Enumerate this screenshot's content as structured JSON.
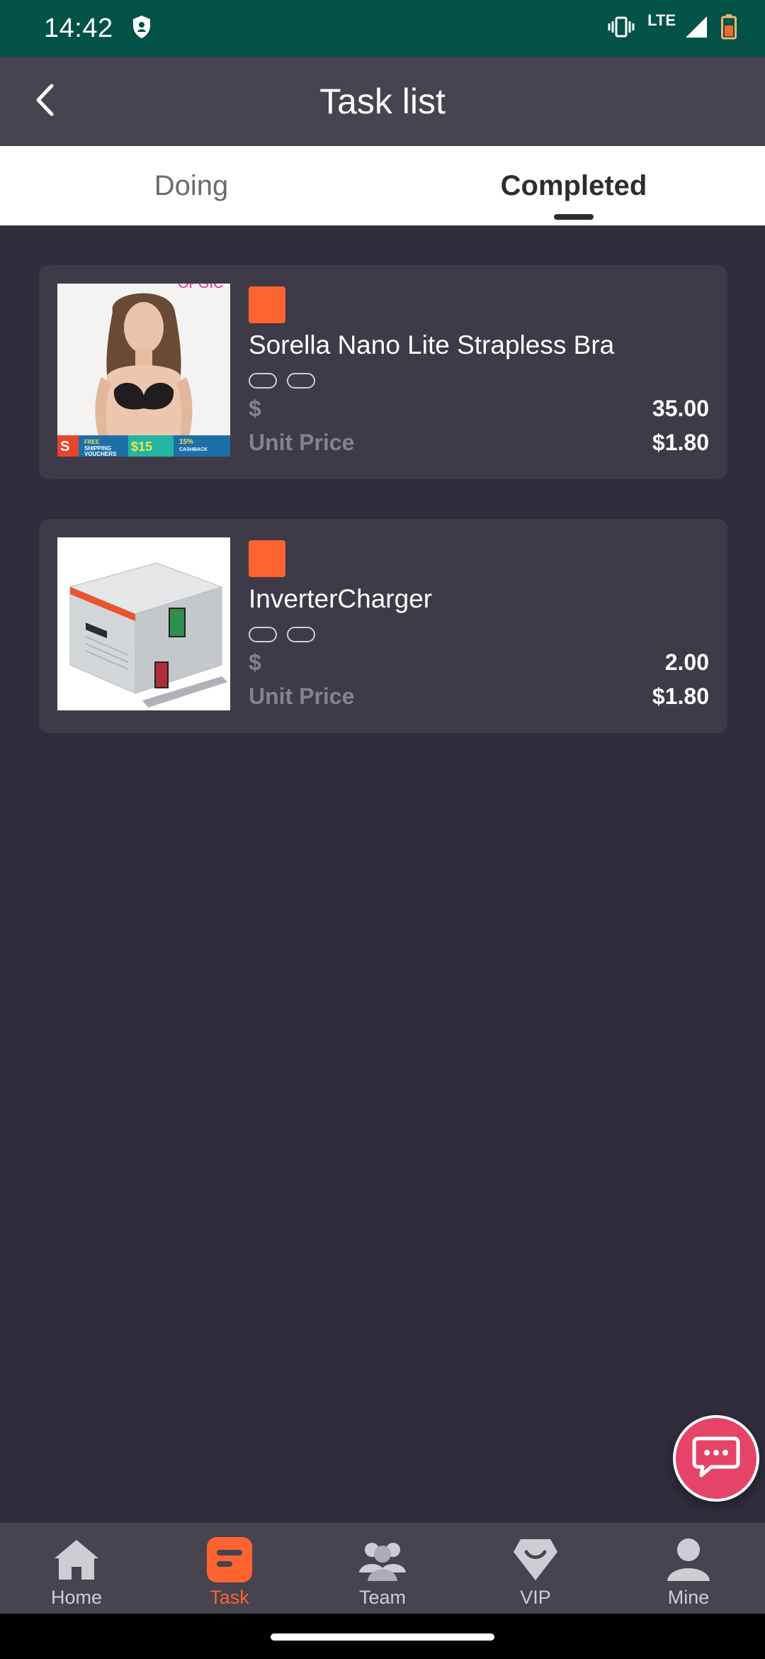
{
  "status_bar": {
    "time": "14:42",
    "network": "LTE",
    "icons": [
      "shield-icon",
      "vibrate-icon",
      "signal-icon",
      "battery-icon"
    ]
  },
  "header": {
    "title": "Task list",
    "back_icon": "chevron-left-icon"
  },
  "tabs": [
    {
      "label": "Doing",
      "active": false
    },
    {
      "label": "Completed",
      "active": true
    }
  ],
  "tasks": [
    {
      "name": "Sorella Nano Lite Strapless Bra",
      "amount_label": "$",
      "amount": "35.00",
      "unit_price_label": "Unit Price",
      "unit_price": "$1.80",
      "image_banner": {
        "free_shipping": "FREE SHIPPING VOUCHERS",
        "price": "$15",
        "cashback": "15% CASHBACK VOUCHERS"
      }
    },
    {
      "name": "InverterCharger",
      "amount_label": "$",
      "amount": "2.00",
      "unit_price_label": "Unit Price",
      "unit_price": "$1.80"
    }
  ],
  "nav": [
    {
      "label": "Home",
      "icon": "home-icon",
      "active": false
    },
    {
      "label": "Task",
      "icon": "task-icon",
      "active": true
    },
    {
      "label": "Team",
      "icon": "team-icon",
      "active": false
    },
    {
      "label": "VIP",
      "icon": "vip-icon",
      "active": false
    },
    {
      "label": "Mine",
      "icon": "user-icon",
      "active": false
    }
  ],
  "colors": {
    "accent": "#fe6330",
    "status_bar": "#035247",
    "background": "#312d3d",
    "card": "#3e3a48",
    "chat_fab": "#e54468"
  }
}
